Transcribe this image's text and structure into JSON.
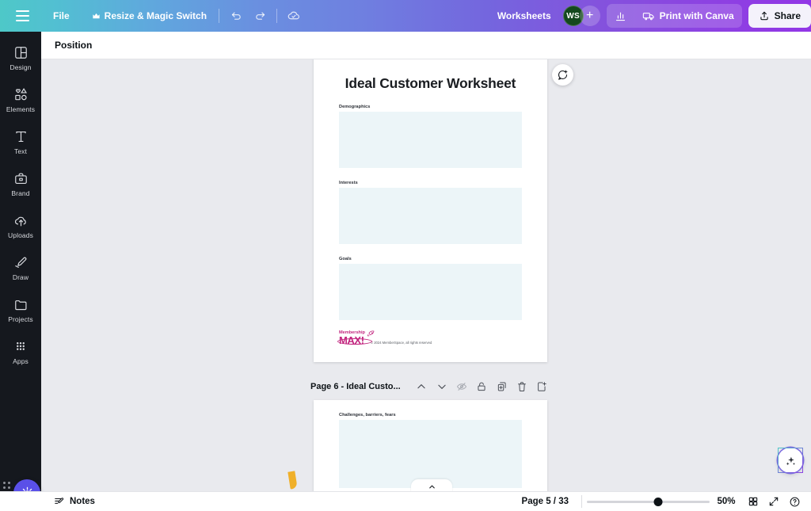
{
  "topbar": {
    "menu_icon": "hamburger-icon",
    "file_label": "File",
    "resize_label": "Resize & Magic Switch",
    "resize_icon": "crown-icon",
    "undo_icon": "undo-icon",
    "redo_icon": "redo-icon",
    "cloud_icon": "cloud-saved-icon",
    "project_name": "Worksheets",
    "avatar_initials": "WS",
    "add_collaborator_icon": "plus-icon",
    "analytics_icon": "bar-chart-icon",
    "print_icon": "print-truck-icon",
    "print_label": "Print with Canva",
    "share_icon": "share-upload-icon",
    "share_label": "Share",
    "gradient_start": "#4ec8c8",
    "gradient_end": "#9236e6"
  },
  "sidebar": {
    "items": [
      {
        "label": "Design",
        "icon": "design-layout-icon"
      },
      {
        "label": "Elements",
        "icon": "elements-shapes-icon"
      },
      {
        "label": "Text",
        "icon": "text-t-icon"
      },
      {
        "label": "Brand",
        "icon": "brand-briefcase-icon"
      },
      {
        "label": "Uploads",
        "icon": "upload-cloud-icon"
      },
      {
        "label": "Draw",
        "icon": "draw-pen-icon"
      },
      {
        "label": "Projects",
        "icon": "folder-icon"
      },
      {
        "label": "Apps",
        "icon": "apps-grid-icon"
      }
    ],
    "ai_orb_icon": "magic-star-icon",
    "drag_handle_icon": "drag-dots-icon"
  },
  "position_bar": {
    "position_label": "Position"
  },
  "canvas": {
    "comment_icon": "add-comment-icon",
    "collapse_icon": "chevron-up-icon",
    "page_5": {
      "title": "Ideal Customer Worksheet",
      "sections": [
        {
          "label": "Demographics"
        },
        {
          "label": "Interests"
        },
        {
          "label": "Goals"
        }
      ],
      "logo_top": "Membership",
      "logo_main": "MAX!",
      "logo_icon": "rocket-icon",
      "copyright": "© 2024 MemberSpace, all rights reserved"
    },
    "page_tools": {
      "title": "Page 6 - Ideal Custo...",
      "icons": [
        {
          "name": "move-page-up-icon",
          "glyph": "chevron-up"
        },
        {
          "name": "move-page-down-icon",
          "glyph": "chevron-down"
        },
        {
          "name": "hide-page-icon",
          "glyph": "eye-slash"
        },
        {
          "name": "lock-page-icon",
          "glyph": "lock"
        },
        {
          "name": "duplicate-page-icon",
          "glyph": "duplicate"
        },
        {
          "name": "delete-page-icon",
          "glyph": "trash"
        },
        {
          "name": "add-page-icon",
          "glyph": "add-page"
        }
      ]
    },
    "page_6": {
      "sections": [
        {
          "label": "Challenges, barriers, fears"
        }
      ]
    }
  },
  "magic_fab": {
    "icon": "magic-sparkles-icon"
  },
  "bottombar": {
    "notes_icon": "notes-pencil-icon",
    "notes_label": "Notes",
    "page_indicator": "Page 5 / 33",
    "zoom_value": "50%",
    "zoom_percent": 50,
    "grid_view_icon": "grid-view-icon",
    "fullscreen_icon": "fullscreen-icon",
    "help_icon": "help-question-icon"
  }
}
